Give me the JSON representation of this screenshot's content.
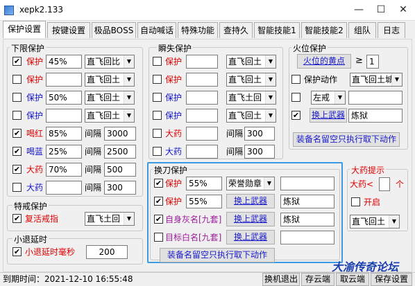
{
  "window": {
    "title": "xepk2.133",
    "minimize": "—",
    "maximize": "☐",
    "close": "✕"
  },
  "tabs": [
    "保护设置",
    "按键设置",
    "极品BOSS",
    "自动喊话",
    "特殊功能",
    "查持久",
    "智能技能1",
    "智能技能2",
    "组队",
    "日志"
  ],
  "lower_limit": {
    "title": "下限保护",
    "rows": [
      {
        "checked": true,
        "label": "保护",
        "color": "red",
        "value": "45%",
        "mode": "直飞回比"
      },
      {
        "checked": false,
        "label": "保护",
        "color": "red",
        "value": "",
        "mode": "直飞回土"
      },
      {
        "checked": false,
        "label": "保护",
        "color": "blue",
        "value": "50%",
        "mode": "直飞回土"
      },
      {
        "checked": false,
        "label": "保护",
        "color": "blue",
        "value": "",
        "mode": "直飞回土"
      },
      {
        "checked": true,
        "label": "喝红",
        "color": "red",
        "value": "85%",
        "interval_label": "间隔",
        "interval": "3000"
      },
      {
        "checked": true,
        "label": "喝蓝",
        "color": "blue",
        "value": "25%",
        "interval_label": "间隔",
        "interval": "2500"
      },
      {
        "checked": true,
        "label": "大药",
        "color": "red",
        "value": "70%",
        "interval_label": "间隔",
        "interval": "500"
      },
      {
        "checked": false,
        "label": "大药",
        "color": "blue",
        "value": "",
        "interval_label": "间隔",
        "interval": "300"
      }
    ]
  },
  "special_ring": {
    "title": "特戒保护",
    "checked": true,
    "label": "复活戒指",
    "mode": "直飞土回"
  },
  "delay": {
    "title": "小退延时",
    "checked": true,
    "label": "小退延时毫秒",
    "value": "200"
  },
  "instant": {
    "title": "瞬失保护",
    "rows": [
      {
        "checked": false,
        "label": "保护",
        "color": "red",
        "value": "",
        "mode": "直飞回土"
      },
      {
        "checked": false,
        "label": "保护",
        "color": "red",
        "value": "",
        "mode": "直飞回土"
      },
      {
        "checked": false,
        "label": "保护",
        "color": "blue",
        "value": "",
        "mode": "直飞土回"
      },
      {
        "checked": false,
        "label": "保护",
        "color": "blue",
        "value": "",
        "mode": "直飞回土"
      },
      {
        "checked": false,
        "label": "大药",
        "color": "red",
        "value": "",
        "interval_label": "间隔",
        "interval": "300"
      },
      {
        "checked": false,
        "label": "大药",
        "color": "blue",
        "value": "",
        "interval_label": "间隔",
        "interval": "300"
      }
    ]
  },
  "fire": {
    "title": "火位保护",
    "yellow_point_button": "火位的黄点",
    "ge_symbol": "≥",
    "ge_value": "1",
    "action_label": "保护动作",
    "action_checked": false,
    "action_mode": "直飞回土城",
    "row2_checked": false,
    "row2_select": "左戒",
    "row2_value": "",
    "row3_checked": true,
    "weapon_button": "换上武器",
    "weapon_value": "炼狱",
    "empty_button": "装备名留空只执行取下动作"
  },
  "swap": {
    "title": "换刀保护",
    "rows": [
      {
        "checked": true,
        "label": "保护",
        "color": "red",
        "value": "55%",
        "select": "荣誉勋章",
        "extra": ""
      },
      {
        "checked": true,
        "label": "保护",
        "color": "red",
        "value": "55%",
        "button": "换上武器",
        "extra": "炼狱"
      },
      {
        "checked": true,
        "label": "自身灰名[九套]",
        "color": "purple",
        "button": "换上武器",
        "extra": "炼狱"
      },
      {
        "checked": false,
        "label": "目标白名[九套]",
        "color": "purple",
        "button": "换上武器",
        "extra": ""
      }
    ],
    "empty_button": "装备名留空只执行取下动作"
  },
  "bigmed": {
    "title": "大药提示",
    "label": "大药<",
    "value": "",
    "unit": "个",
    "open_checked": false,
    "open_label": "开启",
    "mode": "直飞回土"
  },
  "status": {
    "login_time": "到期时间：2021-12-10 16:55:48",
    "btn_logout": "换机退出",
    "btn_save_cloud": "存云端",
    "btn_get_cloud": "取云端",
    "btn_save": "保存设置"
  },
  "watermark": "大渝传奇论坛"
}
